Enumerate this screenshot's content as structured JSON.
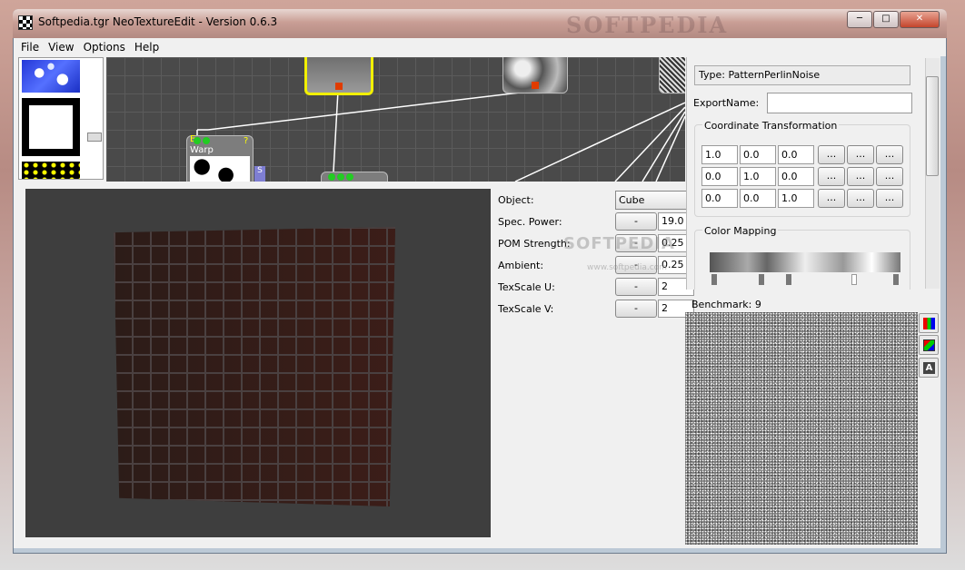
{
  "window": {
    "title": "Softpedia.tgr NeoTextureEdit - Version 0.6.3",
    "watermark": "SOFTPEDIA",
    "controls": {
      "minimize": "─",
      "maximize": "□",
      "close": "✕"
    }
  },
  "menu": [
    "File",
    "View",
    "Options",
    "Help"
  ],
  "graph": {
    "nodes": [
      {
        "label": "Warp",
        "port_letter": "E",
        "help": "?",
        "side": "S"
      }
    ]
  },
  "preview": {
    "object_label": "Object:",
    "object_value": "Cube",
    "params": [
      {
        "label": "Spec. Power:",
        "button": "-",
        "value": "19.0"
      },
      {
        "label": "POM Strength:",
        "button": "-",
        "value": "0.25"
      },
      {
        "label": "Ambient:",
        "button": "-",
        "value": "0.25"
      },
      {
        "label": "TexScale U:",
        "button": "-",
        "value": "2"
      },
      {
        "label": "TexScale V:",
        "button": "-",
        "value": "2"
      }
    ],
    "watermark": "SOFTPEDIA",
    "watermark_url": "www.softpedia.com"
  },
  "properties": {
    "type": "Type: PatternPerlinNoise",
    "export_label": "ExportName:",
    "export_value": "",
    "coord_title": "Coordinate Transformation",
    "matrix": [
      [
        "1.0",
        "0.0",
        "0.0"
      ],
      [
        "0.0",
        "1.0",
        "0.0"
      ],
      [
        "0.0",
        "0.0",
        "1.0"
      ]
    ],
    "dots": "...",
    "color_title": "Color Mapping"
  },
  "benchmark": {
    "label": "Benchmark: 9"
  },
  "side_buttons": [
    "rgb-icon",
    "rgb-slash-icon",
    "alpha-icon"
  ],
  "side_letters": {
    "alpha": "A"
  }
}
